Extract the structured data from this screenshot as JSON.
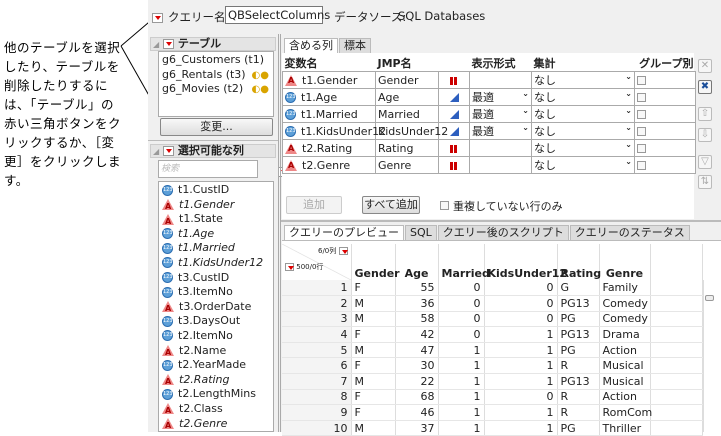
{
  "annotation": "他のテーブルを選択したり、テーブルを削除したりするには、「テーブル」の赤い三角ボタンをクリックするか、［変更］をクリックします。",
  "query": {
    "name_label": "クエリー名:",
    "name_value": "QBSelectColumns",
    "source_label": "データソース:",
    "source_value": "SQL Databases"
  },
  "tables": {
    "title": "テーブル",
    "items": [
      {
        "label": "g6_Customers (t1)",
        "join": false
      },
      {
        "label": "g6_Rentals (t3)",
        "join": true
      },
      {
        "label": "g6_Movies (t2)",
        "join": true
      }
    ],
    "change_button": "変更..."
  },
  "available": {
    "title": "選択可能な列",
    "search_placeholder": "検索",
    "items": [
      {
        "label": "t1.CustID",
        "type": "num",
        "used": false
      },
      {
        "label": "t1.Gender",
        "type": "chr",
        "used": true
      },
      {
        "label": "t1.State",
        "type": "chr",
        "used": false
      },
      {
        "label": "t1.Age",
        "type": "num",
        "used": true
      },
      {
        "label": "t1.Married",
        "type": "num",
        "used": true
      },
      {
        "label": "t1.KidsUnder12",
        "type": "num",
        "used": true
      },
      {
        "label": "t3.CustID",
        "type": "num",
        "used": false
      },
      {
        "label": "t3.ItemNo",
        "type": "num",
        "used": false
      },
      {
        "label": "t3.OrderDate",
        "type": "chr",
        "used": false
      },
      {
        "label": "t3.DaysOut",
        "type": "num",
        "used": false
      },
      {
        "label": "t2.ItemNo",
        "type": "num",
        "used": false
      },
      {
        "label": "t2.Name",
        "type": "chr",
        "used": false
      },
      {
        "label": "t2.YearMade",
        "type": "num",
        "used": false
      },
      {
        "label": "t2.Rating",
        "type": "chr",
        "used": true
      },
      {
        "label": "t2.LengthMins",
        "type": "num",
        "used": false
      },
      {
        "label": "t2.Class",
        "type": "chr",
        "used": false
      },
      {
        "label": "t2.Genre",
        "type": "chr",
        "used": true
      }
    ]
  },
  "include": {
    "tabs": [
      "含める列",
      "標本"
    ],
    "headers": [
      "変数名",
      "JMP名",
      "表示形式",
      "集計",
      "グループ別"
    ],
    "rows": [
      {
        "var": "t1.Gender",
        "jmp": "Gender",
        "type": "chr",
        "format": "",
        "agg": "なし"
      },
      {
        "var": "t1.Age",
        "jmp": "Age",
        "type": "num",
        "format": "最適",
        "agg": "なし"
      },
      {
        "var": "t1.Married",
        "jmp": "Married",
        "type": "num",
        "format": "最適",
        "agg": "なし"
      },
      {
        "var": "t1.KidsUnder12",
        "jmp": "KidsUnder12",
        "type": "num",
        "format": "最適",
        "agg": "なし"
      },
      {
        "var": "t2.Rating",
        "jmp": "Rating",
        "type": "chr",
        "format": "",
        "agg": "なし"
      },
      {
        "var": "t2.Genre",
        "jmp": "Genre",
        "type": "chr",
        "format": "",
        "agg": "なし"
      }
    ],
    "add_button": "追加",
    "add_all_button": "すべて追加",
    "distinct_label": "重複していない行のみ"
  },
  "preview": {
    "tabs": [
      "クエリーのプレビュー",
      "SQL",
      "クエリー後のスクリプト",
      "クエリーのステータス"
    ],
    "cols_count": "6/0列",
    "rows_count": "500/0行",
    "headers": [
      "Gender",
      "Age",
      "Married",
      "KidsUnder12",
      "Rating",
      "Genre"
    ],
    "rows": [
      [
        "1",
        "F",
        "55",
        "0",
        "0",
        "G",
        "Family"
      ],
      [
        "2",
        "M",
        "36",
        "0",
        "0",
        "PG13",
        "Comedy"
      ],
      [
        "3",
        "M",
        "58",
        "0",
        "0",
        "PG",
        "Comedy"
      ],
      [
        "4",
        "F",
        "42",
        "0",
        "1",
        "PG13",
        "Drama"
      ],
      [
        "5",
        "M",
        "47",
        "1",
        "1",
        "PG",
        "Action"
      ],
      [
        "6",
        "F",
        "30",
        "1",
        "1",
        "R",
        "Musical"
      ],
      [
        "7",
        "M",
        "22",
        "1",
        "1",
        "PG13",
        "Musical"
      ],
      [
        "8",
        "F",
        "68",
        "1",
        "0",
        "R",
        "Action"
      ],
      [
        "9",
        "F",
        "46",
        "1",
        "1",
        "R",
        "RomCom"
      ],
      [
        "10",
        "M",
        "37",
        "1",
        "1",
        "PG",
        "Thriller"
      ]
    ]
  }
}
